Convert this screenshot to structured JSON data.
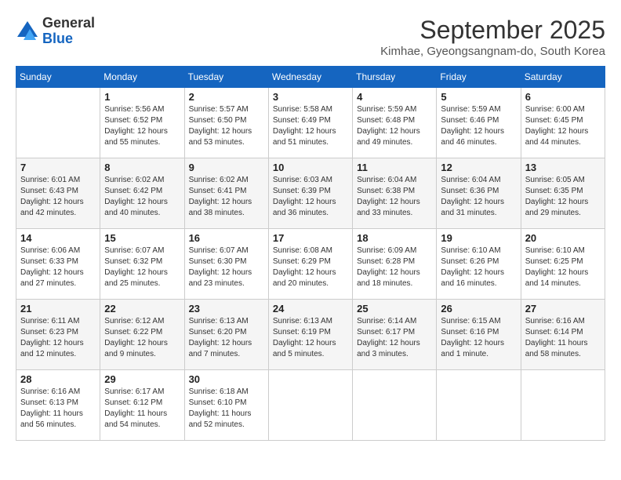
{
  "logo": {
    "general": "General",
    "blue": "Blue"
  },
  "title": "September 2025",
  "subtitle": "Kimhae, Gyeongsangnam-do, South Korea",
  "days_of_week": [
    "Sunday",
    "Monday",
    "Tuesday",
    "Wednesday",
    "Thursday",
    "Friday",
    "Saturday"
  ],
  "weeks": [
    [
      {
        "day": "",
        "info": ""
      },
      {
        "day": "1",
        "info": "Sunrise: 5:56 AM\nSunset: 6:52 PM\nDaylight: 12 hours\nand 55 minutes."
      },
      {
        "day": "2",
        "info": "Sunrise: 5:57 AM\nSunset: 6:50 PM\nDaylight: 12 hours\nand 53 minutes."
      },
      {
        "day": "3",
        "info": "Sunrise: 5:58 AM\nSunset: 6:49 PM\nDaylight: 12 hours\nand 51 minutes."
      },
      {
        "day": "4",
        "info": "Sunrise: 5:59 AM\nSunset: 6:48 PM\nDaylight: 12 hours\nand 49 minutes."
      },
      {
        "day": "5",
        "info": "Sunrise: 5:59 AM\nSunset: 6:46 PM\nDaylight: 12 hours\nand 46 minutes."
      },
      {
        "day": "6",
        "info": "Sunrise: 6:00 AM\nSunset: 6:45 PM\nDaylight: 12 hours\nand 44 minutes."
      }
    ],
    [
      {
        "day": "7",
        "info": "Sunrise: 6:01 AM\nSunset: 6:43 PM\nDaylight: 12 hours\nand 42 minutes."
      },
      {
        "day": "8",
        "info": "Sunrise: 6:02 AM\nSunset: 6:42 PM\nDaylight: 12 hours\nand 40 minutes."
      },
      {
        "day": "9",
        "info": "Sunrise: 6:02 AM\nSunset: 6:41 PM\nDaylight: 12 hours\nand 38 minutes."
      },
      {
        "day": "10",
        "info": "Sunrise: 6:03 AM\nSunset: 6:39 PM\nDaylight: 12 hours\nand 36 minutes."
      },
      {
        "day": "11",
        "info": "Sunrise: 6:04 AM\nSunset: 6:38 PM\nDaylight: 12 hours\nand 33 minutes."
      },
      {
        "day": "12",
        "info": "Sunrise: 6:04 AM\nSunset: 6:36 PM\nDaylight: 12 hours\nand 31 minutes."
      },
      {
        "day": "13",
        "info": "Sunrise: 6:05 AM\nSunset: 6:35 PM\nDaylight: 12 hours\nand 29 minutes."
      }
    ],
    [
      {
        "day": "14",
        "info": "Sunrise: 6:06 AM\nSunset: 6:33 PM\nDaylight: 12 hours\nand 27 minutes."
      },
      {
        "day": "15",
        "info": "Sunrise: 6:07 AM\nSunset: 6:32 PM\nDaylight: 12 hours\nand 25 minutes."
      },
      {
        "day": "16",
        "info": "Sunrise: 6:07 AM\nSunset: 6:30 PM\nDaylight: 12 hours\nand 23 minutes."
      },
      {
        "day": "17",
        "info": "Sunrise: 6:08 AM\nSunset: 6:29 PM\nDaylight: 12 hours\nand 20 minutes."
      },
      {
        "day": "18",
        "info": "Sunrise: 6:09 AM\nSunset: 6:28 PM\nDaylight: 12 hours\nand 18 minutes."
      },
      {
        "day": "19",
        "info": "Sunrise: 6:10 AM\nSunset: 6:26 PM\nDaylight: 12 hours\nand 16 minutes."
      },
      {
        "day": "20",
        "info": "Sunrise: 6:10 AM\nSunset: 6:25 PM\nDaylight: 12 hours\nand 14 minutes."
      }
    ],
    [
      {
        "day": "21",
        "info": "Sunrise: 6:11 AM\nSunset: 6:23 PM\nDaylight: 12 hours\nand 12 minutes."
      },
      {
        "day": "22",
        "info": "Sunrise: 6:12 AM\nSunset: 6:22 PM\nDaylight: 12 hours\nand 9 minutes."
      },
      {
        "day": "23",
        "info": "Sunrise: 6:13 AM\nSunset: 6:20 PM\nDaylight: 12 hours\nand 7 minutes."
      },
      {
        "day": "24",
        "info": "Sunrise: 6:13 AM\nSunset: 6:19 PM\nDaylight: 12 hours\nand 5 minutes."
      },
      {
        "day": "25",
        "info": "Sunrise: 6:14 AM\nSunset: 6:17 PM\nDaylight: 12 hours\nand 3 minutes."
      },
      {
        "day": "26",
        "info": "Sunrise: 6:15 AM\nSunset: 6:16 PM\nDaylight: 12 hours\nand 1 minute."
      },
      {
        "day": "27",
        "info": "Sunrise: 6:16 AM\nSunset: 6:14 PM\nDaylight: 11 hours\nand 58 minutes."
      }
    ],
    [
      {
        "day": "28",
        "info": "Sunrise: 6:16 AM\nSunset: 6:13 PM\nDaylight: 11 hours\nand 56 minutes."
      },
      {
        "day": "29",
        "info": "Sunrise: 6:17 AM\nSunset: 6:12 PM\nDaylight: 11 hours\nand 54 minutes."
      },
      {
        "day": "30",
        "info": "Sunrise: 6:18 AM\nSunset: 6:10 PM\nDaylight: 11 hours\nand 52 minutes."
      },
      {
        "day": "",
        "info": ""
      },
      {
        "day": "",
        "info": ""
      },
      {
        "day": "",
        "info": ""
      },
      {
        "day": "",
        "info": ""
      }
    ]
  ]
}
